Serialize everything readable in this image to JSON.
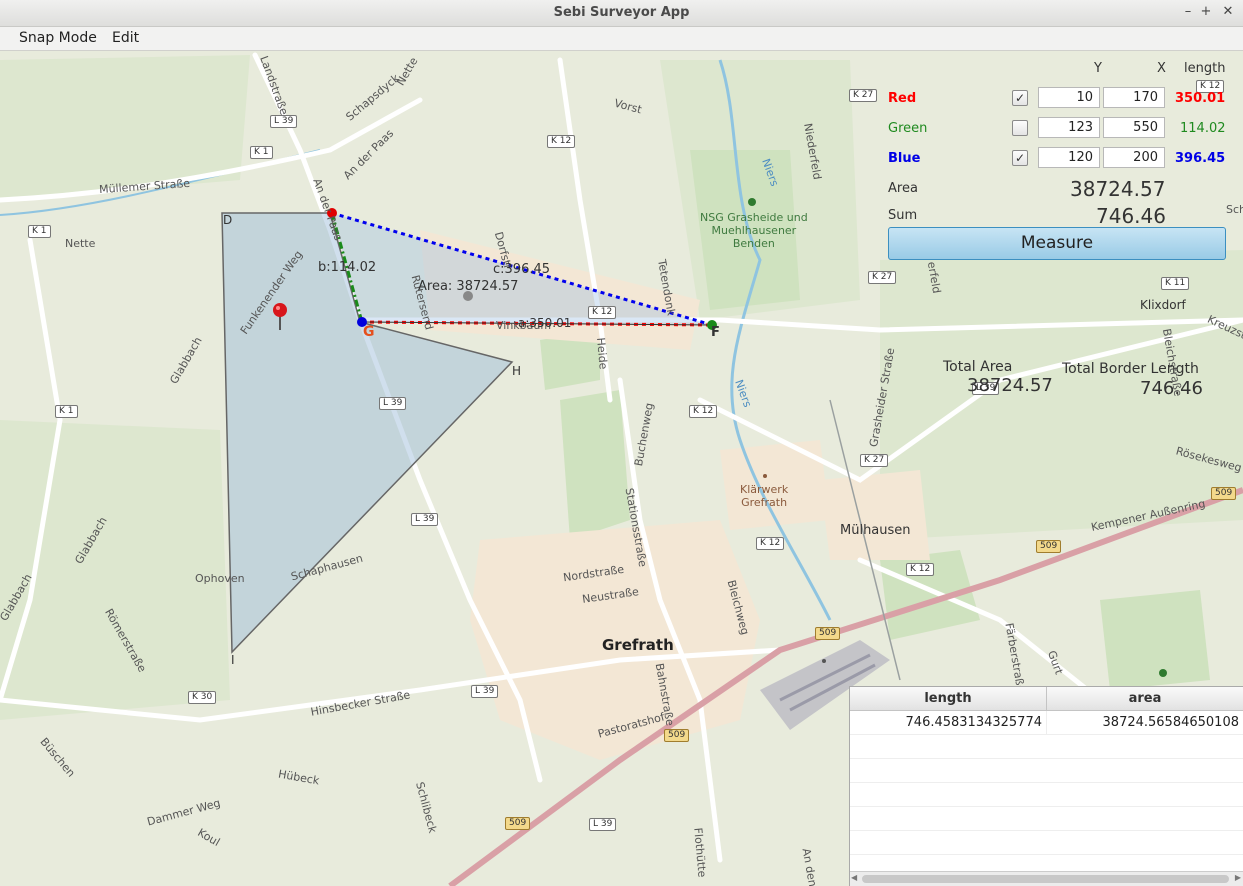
{
  "window": {
    "title": "Sebi Surveyor App",
    "min": "–",
    "max": "+",
    "close": "✕"
  },
  "menu": [
    "Snap Mode",
    "Edit"
  ],
  "panel": {
    "col_y": "Y",
    "col_x": "X",
    "col_length": "length",
    "rows": [
      {
        "label": "Red",
        "color": "#ff0000",
        "checked": true,
        "check_glyph": "✓",
        "y": "10",
        "x": "170",
        "length": "350.01"
      },
      {
        "label": "Green",
        "color": "#1f8a1f",
        "checked": false,
        "check_glyph": "",
        "y": "123",
        "x": "550",
        "length": "114.02"
      },
      {
        "label": "Blue",
        "color": "#0000e6",
        "checked": true,
        "check_glyph": "✓",
        "y": "120",
        "x": "200",
        "length": "396.45"
      }
    ],
    "area_label": "Area",
    "area_value": "38724.57",
    "sum_label": "Sum",
    "sum_value": "746.46",
    "measure_button": "Measure"
  },
  "totals": {
    "area_label": "Total Area",
    "area_value": "38724.57",
    "border_label": "Total Border Length",
    "border_value": "746.46"
  },
  "overlay": {
    "label_b": "b:114.02",
    "label_c": "c:396.45",
    "label_a": "a:350.01",
    "label_area": "Area: 38724.57",
    "vertex_d": "D",
    "vertex_f": "F",
    "vertex_g": "G",
    "vertex_h": "H",
    "vertex_i": "I"
  },
  "map": {
    "places": [
      "Müllemer Straße",
      "Nette",
      "Landstraße",
      "Schapsdyck",
      "Nette",
      "An der Paas",
      "An der Paas",
      "Vorst",
      "Funkenender Weg",
      "Dorfstr",
      "Rütersend",
      "Glabbach",
      "Glabbach",
      "Tetendonk",
      "Heide",
      "Vinkbaum",
      "Niederfeld",
      "Niers",
      "NSG Grasheide und\nMuehlhausener\nBenden",
      "Klixdorf",
      "Kreuzstraße",
      "Grasheider Straße",
      "Rösekesweg",
      "Mülhausen",
      "Kempener Außenring",
      "Buchenweg",
      "Stationsstraße",
      "Nordstraße",
      "Neustraße",
      "Grefrath",
      "Bahnstraße",
      "Bleichweg",
      "Klärwerk\nGrefrath",
      "Ophoven",
      "Schaphausen",
      "Römerstraße",
      "Hinsbecker Straße",
      "Büschen",
      "Hübeck",
      "Dammer Weg",
      "Koul",
      "Schlibeck",
      "Pastoratshof",
      "Flothütte",
      "Färberstraße",
      "Gurt",
      "Bleichstraße",
      "Niers",
      "Glabbach",
      "Sch",
      "erfeld",
      "An den"
    ],
    "roads": [
      "L 39",
      "K 1",
      "K 1",
      "K 12",
      "K 27",
      "K 12",
      "L 39",
      "K 12",
      "K 12",
      "K 27",
      "K 27",
      "K 11",
      "L 39",
      "L 39",
      "K 1",
      "K 30",
      "L 39",
      "L 39",
      "K 12",
      "509",
      "509",
      "509",
      "509",
      "509",
      "K 12"
    ]
  },
  "table": {
    "headers": [
      "length",
      "area"
    ],
    "rows": [
      [
        "746.4583134325774",
        "38724.56584650108"
      ]
    ],
    "scroll_left": "◀",
    "scroll_right": "▶"
  }
}
